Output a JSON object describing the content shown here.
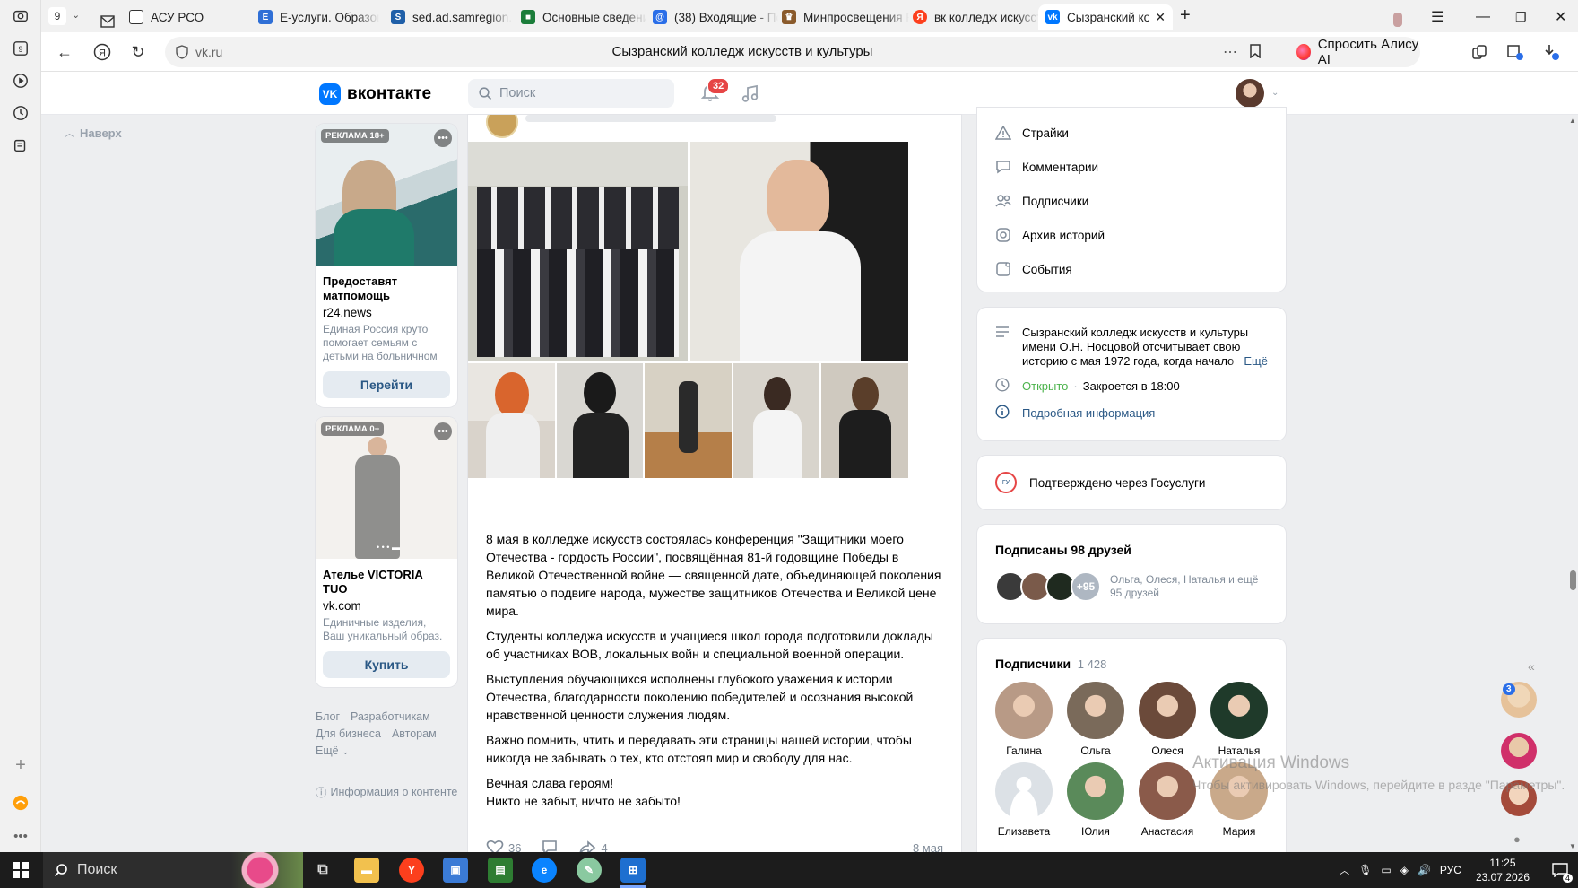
{
  "browser": {
    "tab_count": "9",
    "tabs": [
      {
        "label": "АСУ РСО",
        "color": "#ffffff"
      },
      {
        "label": "Е-услуги. Образова",
        "color": "#2f6fd6"
      },
      {
        "label": "sed.ad.samregion.ru",
        "color": "#1f5fa8"
      },
      {
        "label": "Основные сведени",
        "color": "#1b7d3a"
      },
      {
        "label": "(38) Входящие - По",
        "color": "#2a6ee8"
      },
      {
        "label": "Минпросвещения Р",
        "color": "#8a5a2b"
      },
      {
        "label": "вк колледж искусст",
        "color": "#fc3f1d"
      },
      {
        "label": "Сызранский кол",
        "color": "#0077ff"
      }
    ],
    "url": "vk.ru",
    "page_title": "Сызранский колледж искусств и культуры",
    "alice_label": "Спросить Алису AI"
  },
  "vk": {
    "logo_text": "вконтакте",
    "search_placeholder": "Поиск",
    "notifications_count": "32",
    "back_to_top": "Наверх"
  },
  "ads": [
    {
      "label": "РЕКЛАМА 18+",
      "title": "Предоставят матпомощь",
      "domain": "r24.news",
      "description": "Единая Россия круто помогает семьям с детьми на больничном",
      "button": "Перейти"
    },
    {
      "label": "РЕКЛАМА 0+",
      "title": "Ателье VICTORIA TUO",
      "domain": "vk.com",
      "description": "Единичные изделия, Ваш уникальный образ.",
      "button": "Купить"
    }
  ],
  "footer_links": {
    "blog": "Блог",
    "developers": "Разработчикам",
    "business": "Для бизнеса",
    "authors": "Авторам",
    "more": "Ещё",
    "content_info": "Информация о контенте"
  },
  "post": {
    "paragraphs": [
      "8 мая в колледже искусств состоялась конференция \"Защитники моего Отечества - гордость России\", посвящённая 81-й годовщине Победы в Великой Отечественной войне — священной дате, объединяющей поколения памятью о подвиге народа, мужестве защитников Отечества и Великой цене мира.",
      "Студенты колледжа искусств и учащиеся школ города подготовили доклады об участниках ВОВ, локальных войн и специальной военной операции.",
      "Выступления обучающихся исполнены глубокого уважения к истории Отечества, благодарности поколению победителей и осознания высокой нравственной ценности служения людям.",
      "Важно помнить, чтить и передавать эти страницы нашей истории, чтобы никогда не забывать о тех, кто отстоял мир и свободу для нас.",
      "Вечная слава героям!\nНикто не забыт, ничто не забыто!"
    ],
    "likes": "36",
    "reposts": "4",
    "date": "8 мая"
  },
  "menu": {
    "items": [
      "Страйки",
      "Комментарии",
      "Подписчики",
      "Архив историй",
      "События"
    ]
  },
  "about": {
    "description": "Сызранский колледж искусств и культуры имени О.Н. Носцовой отсчитывает свою историю с мая 1972 года, когда начало",
    "more": "Ещё",
    "status_open": "Открыто",
    "status_sep": "·",
    "closes": "Закроется в 18:00",
    "details_link": "Подробная информация"
  },
  "verified": {
    "text": "Подтверждено через Госуслуги"
  },
  "friends": {
    "title": "Подписаны 98 друзей",
    "more_count": "+95",
    "names_line1": "Ольга, Олеся, Наталья и ещё",
    "names_line2": "95 друзей"
  },
  "subscribers": {
    "title": "Подписчики",
    "count": "1 428",
    "people": [
      {
        "name": "Галина",
        "color": "#b89a86"
      },
      {
        "name": "Ольга",
        "color": "#7a6a5a"
      },
      {
        "name": "Олеся",
        "color": "#6b4a3a"
      },
      {
        "name": "Наталья",
        "color": "#1f3a2a"
      },
      {
        "name": "Елизавета",
        "color": "#e1e3e6"
      },
      {
        "name": "Юлия",
        "color": "#5a8a5a"
      },
      {
        "name": "Анастасия",
        "color": "#8a5a4a"
      },
      {
        "name": "Мария",
        "color": "#c9a98a"
      }
    ]
  },
  "side_panel": {
    "badge": "3"
  },
  "watermark": {
    "title": "Активация Windows",
    "subtitle": "Чтобы активировать Windows, перейдите в разде \"Параметры\"."
  },
  "taskbar": {
    "search": "Поиск",
    "lang": "РУС",
    "time": "11:25",
    "date": "23.07.2026",
    "notif_count": "4"
  }
}
